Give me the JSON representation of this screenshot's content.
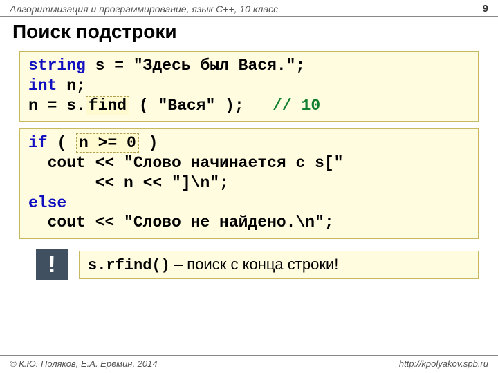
{
  "header": {
    "course": "Алгоритмизация и программирование, язык C++, 10 класс",
    "page": "9"
  },
  "title": "Поиск подстроки",
  "code1": {
    "l1a": "string",
    "l1b": " s = ",
    "l1c": "\"Здесь был Вася.\"",
    "l1d": ";",
    "l2a": "int",
    "l2b": " n;",
    "l3a": "n = s.",
    "l3b": "find",
    "l3c": " ( ",
    "l3d": "\"Вася\"",
    "l3e": " );   ",
    "l3f": "// 10"
  },
  "code2": {
    "l1a": "if",
    "l1b": " ( ",
    "l1c": "n >= 0",
    "l1d": " )",
    "l2a": "  cout << ",
    "l2b": "\"Слово начинается с s[\"",
    "l3a": "       << n << ",
    "l3b": "\"]\\n\"",
    "l3c": ";",
    "l4a": "else",
    "l5a": "  cout << ",
    "l5b": "\"Слово не найдено.\\n\"",
    "l5c": ";"
  },
  "note": {
    "bang": "!",
    "code": "s.rfind()",
    "text": " – поиск с конца строки!"
  },
  "footer": {
    "left": "© К.Ю. Поляков, Е.А. Еремин, 2014",
    "right": "http://kpolyakov.spb.ru"
  }
}
